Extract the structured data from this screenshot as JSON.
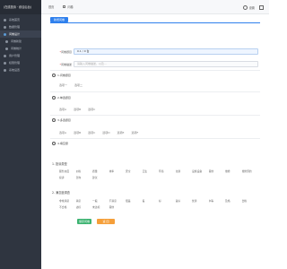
{
  "sidebar": {
    "brand": "(在线投诉 · 综合后台)",
    "items": [
      {
        "label": "系统首页",
        "active": false,
        "sub": false
      },
      {
        "label": "数据管理",
        "active": false,
        "sub": false
      },
      {
        "label": "问卷设计",
        "active": true,
        "sub": false
      },
      {
        "label": "问卷新建",
        "active": false,
        "sub": true
      },
      {
        "label": "问卷统计",
        "active": false,
        "sub": true
      },
      {
        "label": "用户管理",
        "active": false,
        "sub": false
      },
      {
        "label": "权限管理",
        "active": false,
        "sub": false
      },
      {
        "label": "系统设置",
        "active": false,
        "sub": false
      }
    ]
  },
  "topbar": {
    "tabs": [
      "首页",
      "问卷"
    ],
    "settings_label": "设置",
    "expand_label": ""
  },
  "main": {
    "add_tab": "新增问卷",
    "fields": {
      "title_label": "问卷题目",
      "title_value": "0.1 / 0 台",
      "desc_label": "问卷描述",
      "desc_placeholder": "请输入问卷描述，以及..."
    },
    "questions": [
      {
        "title": "1.问卷题目",
        "options": [
          "选项一",
          "选项二"
        ]
      },
      {
        "title": "2.单选题目",
        "options": [
          "选项A",
          "选项B",
          "选项C"
        ]
      },
      {
        "title": "3.多选题目",
        "options": [
          "选项A",
          "选项B",
          "选项C",
          "选项D",
          "选项E",
          "选项F"
        ]
      },
      {
        "title": "4.填空题",
        "options": []
      }
    ],
    "groups": [
      {
        "title": "1. 投诉类型",
        "items": [
          "服务态度",
          "价格",
          "质量",
          "效率",
          "安全",
          "卫生",
          "环境",
          "交通",
          "设施设备",
          "其他",
          "维修",
          "维修预约",
          "投诉",
          "咨询",
          "建议"
        ]
      },
      {
        "title": "2. 满意度调查",
        "items": [
          "非常满意",
          "满意",
          "一般",
          "不满意",
          "很差",
          "差",
          "好",
          "良好",
          "优秀",
          "中等",
          "及格",
          "合格",
          "不合格",
          "达标",
          "未达标",
          "其他"
        ]
      }
    ],
    "save_label": "保存问卷",
    "back_label": "返 回"
  },
  "colors": {
    "sidebar_bg": "#2f3540",
    "accent": "#2f80ed",
    "save": "#3cb371",
    "back": "#f59f3a"
  }
}
